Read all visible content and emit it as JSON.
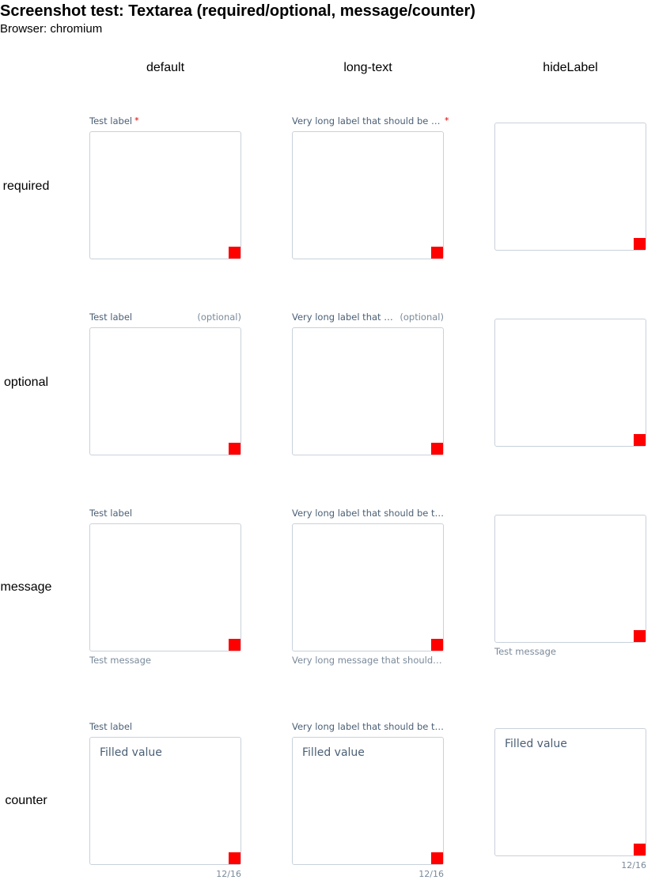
{
  "header": {
    "title": "Screenshot test: Textarea (required/optional, message/counter)",
    "browser": "Browser: chromium"
  },
  "columns": [
    "default",
    "long-text",
    "hideLabel"
  ],
  "rows": [
    "required",
    "optional",
    "message",
    "counter"
  ],
  "labels": {
    "short": "Test label",
    "long_required": "Very long label that should be tr…",
    "long_optional": "Very long label that s…",
    "long_plain": "Very long label that should be tru…",
    "required_mark": "*",
    "optional_mark": "(optional)"
  },
  "messages": {
    "short": "Test message",
    "long": "Very long message that should b…"
  },
  "counter": {
    "value": "Filled value",
    "count": "12/16"
  },
  "colors": {
    "label": "#4a5f75",
    "required": "#d40000",
    "border": "#c9d1da",
    "resize_grip": "#ff0000"
  }
}
